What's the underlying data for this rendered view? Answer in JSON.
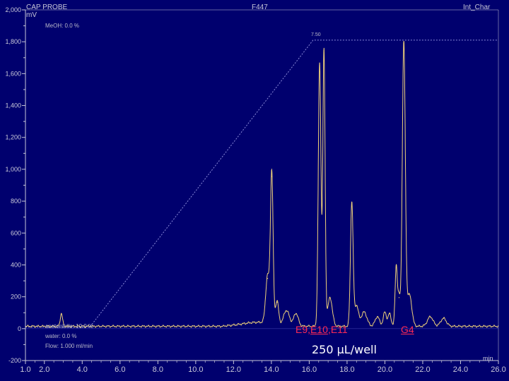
{
  "header": {
    "left_title": "CAP PROBE",
    "center_title": "F447",
    "right_title": "Int_Char",
    "y_unit": "mV",
    "mobile_phase_note": "MeOH: 0.0 %"
  },
  "conditions": {
    "line1": "acetonitrile: 10.0 %",
    "line2": "water: 0.0 %",
    "line3": "Flow: 1.000 ml/min"
  },
  "annotations": {
    "peak_top_label": "7.50",
    "fraction_e9": "E9,",
    "fraction_e10": "E10",
    "fraction_e11": ",E11",
    "fraction_g4": "G4",
    "volume": "250 µL/well"
  },
  "colors": {
    "background": "#00006e",
    "axis": "#c8c8d8",
    "trace": "#f0d27a",
    "gradient": "#8a8ad8",
    "label_red": "#ff2a55"
  },
  "chart_data": {
    "type": "line",
    "xlabel": "min",
    "ylabel": "mV",
    "xlim": [
      1.0,
      26.0
    ],
    "ylim": [
      -200,
      2000
    ],
    "x_ticks": [
      "1.0",
      "2.0",
      "4.0",
      "6.0",
      "8.0",
      "10.0",
      "12.0",
      "14.0",
      "16.0",
      "18.0",
      "20.0",
      "22.0",
      "24.0",
      "26.0"
    ],
    "y_ticks": [
      "2,000",
      "1,800",
      "1,600",
      "1,400",
      "1,200",
      "1,000",
      "800",
      "600",
      "400",
      "200",
      "0",
      "-200"
    ],
    "baseline": 15,
    "peaks": [
      {
        "x": 2.9,
        "height": 80,
        "width": 0.06
      },
      {
        "x": 13.8,
        "height": 300,
        "width": 0.1
      },
      {
        "x": 14.02,
        "height": 940,
        "width": 0.07
      },
      {
        "x": 14.3,
        "height": 150,
        "width": 0.08
      },
      {
        "x": 14.8,
        "height": 95,
        "width": 0.15
      },
      {
        "x": 15.3,
        "height": 80,
        "width": 0.12
      },
      {
        "x": 16.55,
        "height": 1650,
        "width": 0.07
      },
      {
        "x": 16.78,
        "height": 1730,
        "width": 0.06
      },
      {
        "x": 17.1,
        "height": 180,
        "width": 0.12
      },
      {
        "x": 18.25,
        "height": 780,
        "width": 0.07
      },
      {
        "x": 18.5,
        "height": 130,
        "width": 0.1
      },
      {
        "x": 18.9,
        "height": 90,
        "width": 0.15
      },
      {
        "x": 19.6,
        "height": 60,
        "width": 0.12
      },
      {
        "x": 20.0,
        "height": 90,
        "width": 0.08
      },
      {
        "x": 20.25,
        "height": 80,
        "width": 0.08
      },
      {
        "x": 20.6,
        "height": 380,
        "width": 0.06
      },
      {
        "x": 20.75,
        "height": 180,
        "width": 0.06
      },
      {
        "x": 21.0,
        "height": 1780,
        "width": 0.08
      },
      {
        "x": 21.3,
        "height": 200,
        "width": 0.12
      },
      {
        "x": 22.4,
        "height": 60,
        "width": 0.15
      },
      {
        "x": 23.1,
        "height": 50,
        "width": 0.15
      }
    ],
    "gradient": {
      "x": [
        1.0,
        4.4,
        16.2,
        26.0
      ],
      "y": [
        10,
        10,
        1810,
        1810
      ]
    }
  }
}
